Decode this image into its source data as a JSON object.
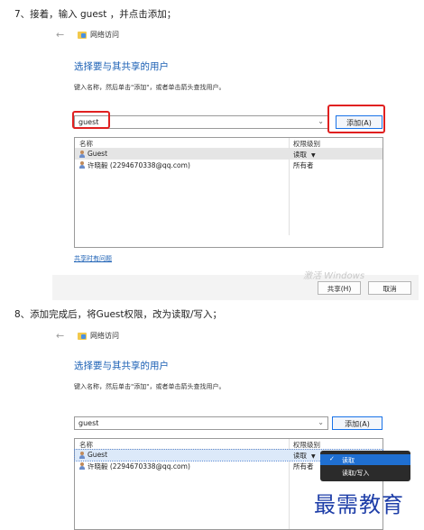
{
  "step7": {
    "text": "7、接着，输入 guest ，并点击添加；",
    "nav_title": "网络访问",
    "heading": "选择要与其共享的用户",
    "hint": "键入名称，然后单击\"添加\"，或者单击箭头查找用户。",
    "combo_value": "guest",
    "add_button": "添加(A)",
    "columns": [
      "名称",
      "权限级别"
    ],
    "rows": [
      {
        "name": "Guest",
        "perm": "读取",
        "has_arrow": true
      },
      {
        "name": "许晓毅 (2294670338@qq.com)",
        "perm": "所有者",
        "has_arrow": false
      }
    ],
    "link": "共享时有问题",
    "share_button": "共享(H)",
    "cancel_button": "取消",
    "watermark": "激活 Windows"
  },
  "step8": {
    "text": "8、添加完成后，将Guest权限，改为读取/写入；",
    "nav_title": "网络访问",
    "heading": "选择要与其共享的用户",
    "hint": "键入名称，然后单击\"添加\"，或者单击箭头查找用户。",
    "combo_value": "guest",
    "add_button": "添加(A)",
    "columns": [
      "名称",
      "权限级别"
    ],
    "rows": [
      {
        "name": "Guest",
        "perm": "读取",
        "has_arrow": true
      },
      {
        "name": "许晓毅 (2294670338@qq.com)",
        "perm": "所有者",
        "has_arrow": false
      }
    ],
    "dropdown": [
      {
        "label": "读取",
        "checked": true
      },
      {
        "label": "读取/写入",
        "checked": false
      }
    ]
  },
  "watermark_brand": "最需教育",
  "colors": {
    "accent": "#1a5fb4",
    "highlight": "#e02020",
    "dropdown_bg": "#2b2b2b",
    "dropdown_sel": "#1f6fd1"
  }
}
